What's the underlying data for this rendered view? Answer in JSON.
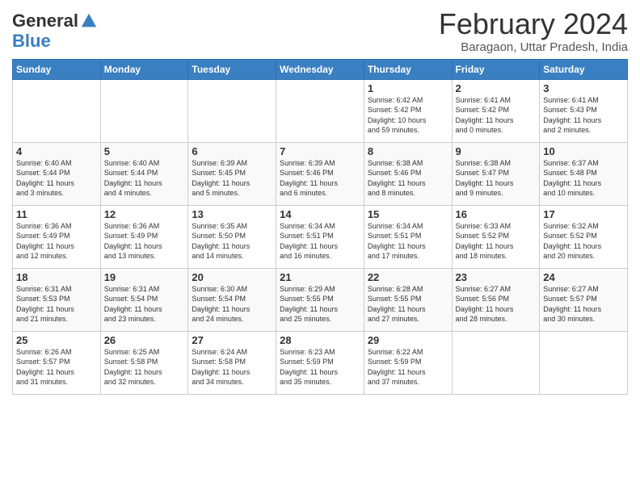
{
  "logo": {
    "general": "General",
    "blue": "Blue"
  },
  "header": {
    "month_year": "February 2024",
    "location": "Baragaon, Uttar Pradesh, India"
  },
  "weekdays": [
    "Sunday",
    "Monday",
    "Tuesday",
    "Wednesday",
    "Thursday",
    "Friday",
    "Saturday"
  ],
  "weeks": [
    [
      {
        "day": "",
        "info": ""
      },
      {
        "day": "",
        "info": ""
      },
      {
        "day": "",
        "info": ""
      },
      {
        "day": "",
        "info": ""
      },
      {
        "day": "1",
        "info": "Sunrise: 6:42 AM\nSunset: 5:42 PM\nDaylight: 10 hours\nand 59 minutes."
      },
      {
        "day": "2",
        "info": "Sunrise: 6:41 AM\nSunset: 5:42 PM\nDaylight: 11 hours\nand 0 minutes."
      },
      {
        "day": "3",
        "info": "Sunrise: 6:41 AM\nSunset: 5:43 PM\nDaylight: 11 hours\nand 2 minutes."
      }
    ],
    [
      {
        "day": "4",
        "info": "Sunrise: 6:40 AM\nSunset: 5:44 PM\nDaylight: 11 hours\nand 3 minutes."
      },
      {
        "day": "5",
        "info": "Sunrise: 6:40 AM\nSunset: 5:44 PM\nDaylight: 11 hours\nand 4 minutes."
      },
      {
        "day": "6",
        "info": "Sunrise: 6:39 AM\nSunset: 5:45 PM\nDaylight: 11 hours\nand 5 minutes."
      },
      {
        "day": "7",
        "info": "Sunrise: 6:39 AM\nSunset: 5:46 PM\nDaylight: 11 hours\nand 6 minutes."
      },
      {
        "day": "8",
        "info": "Sunrise: 6:38 AM\nSunset: 5:46 PM\nDaylight: 11 hours\nand 8 minutes."
      },
      {
        "day": "9",
        "info": "Sunrise: 6:38 AM\nSunset: 5:47 PM\nDaylight: 11 hours\nand 9 minutes."
      },
      {
        "day": "10",
        "info": "Sunrise: 6:37 AM\nSunset: 5:48 PM\nDaylight: 11 hours\nand 10 minutes."
      }
    ],
    [
      {
        "day": "11",
        "info": "Sunrise: 6:36 AM\nSunset: 5:49 PM\nDaylight: 11 hours\nand 12 minutes."
      },
      {
        "day": "12",
        "info": "Sunrise: 6:36 AM\nSunset: 5:49 PM\nDaylight: 11 hours\nand 13 minutes."
      },
      {
        "day": "13",
        "info": "Sunrise: 6:35 AM\nSunset: 5:50 PM\nDaylight: 11 hours\nand 14 minutes."
      },
      {
        "day": "14",
        "info": "Sunrise: 6:34 AM\nSunset: 5:51 PM\nDaylight: 11 hours\nand 16 minutes."
      },
      {
        "day": "15",
        "info": "Sunrise: 6:34 AM\nSunset: 5:51 PM\nDaylight: 11 hours\nand 17 minutes."
      },
      {
        "day": "16",
        "info": "Sunrise: 6:33 AM\nSunset: 5:52 PM\nDaylight: 11 hours\nand 18 minutes."
      },
      {
        "day": "17",
        "info": "Sunrise: 6:32 AM\nSunset: 5:52 PM\nDaylight: 11 hours\nand 20 minutes."
      }
    ],
    [
      {
        "day": "18",
        "info": "Sunrise: 6:31 AM\nSunset: 5:53 PM\nDaylight: 11 hours\nand 21 minutes."
      },
      {
        "day": "19",
        "info": "Sunrise: 6:31 AM\nSunset: 5:54 PM\nDaylight: 11 hours\nand 23 minutes."
      },
      {
        "day": "20",
        "info": "Sunrise: 6:30 AM\nSunset: 5:54 PM\nDaylight: 11 hours\nand 24 minutes."
      },
      {
        "day": "21",
        "info": "Sunrise: 6:29 AM\nSunset: 5:55 PM\nDaylight: 11 hours\nand 25 minutes."
      },
      {
        "day": "22",
        "info": "Sunrise: 6:28 AM\nSunset: 5:55 PM\nDaylight: 11 hours\nand 27 minutes."
      },
      {
        "day": "23",
        "info": "Sunrise: 6:27 AM\nSunset: 5:56 PM\nDaylight: 11 hours\nand 28 minutes."
      },
      {
        "day": "24",
        "info": "Sunrise: 6:27 AM\nSunset: 5:57 PM\nDaylight: 11 hours\nand 30 minutes."
      }
    ],
    [
      {
        "day": "25",
        "info": "Sunrise: 6:26 AM\nSunset: 5:57 PM\nDaylight: 11 hours\nand 31 minutes."
      },
      {
        "day": "26",
        "info": "Sunrise: 6:25 AM\nSunset: 5:58 PM\nDaylight: 11 hours\nand 32 minutes."
      },
      {
        "day": "27",
        "info": "Sunrise: 6:24 AM\nSunset: 5:58 PM\nDaylight: 11 hours\nand 34 minutes."
      },
      {
        "day": "28",
        "info": "Sunrise: 6:23 AM\nSunset: 5:59 PM\nDaylight: 11 hours\nand 35 minutes."
      },
      {
        "day": "29",
        "info": "Sunrise: 6:22 AM\nSunset: 5:59 PM\nDaylight: 11 hours\nand 37 minutes."
      },
      {
        "day": "",
        "info": ""
      },
      {
        "day": "",
        "info": ""
      }
    ]
  ]
}
